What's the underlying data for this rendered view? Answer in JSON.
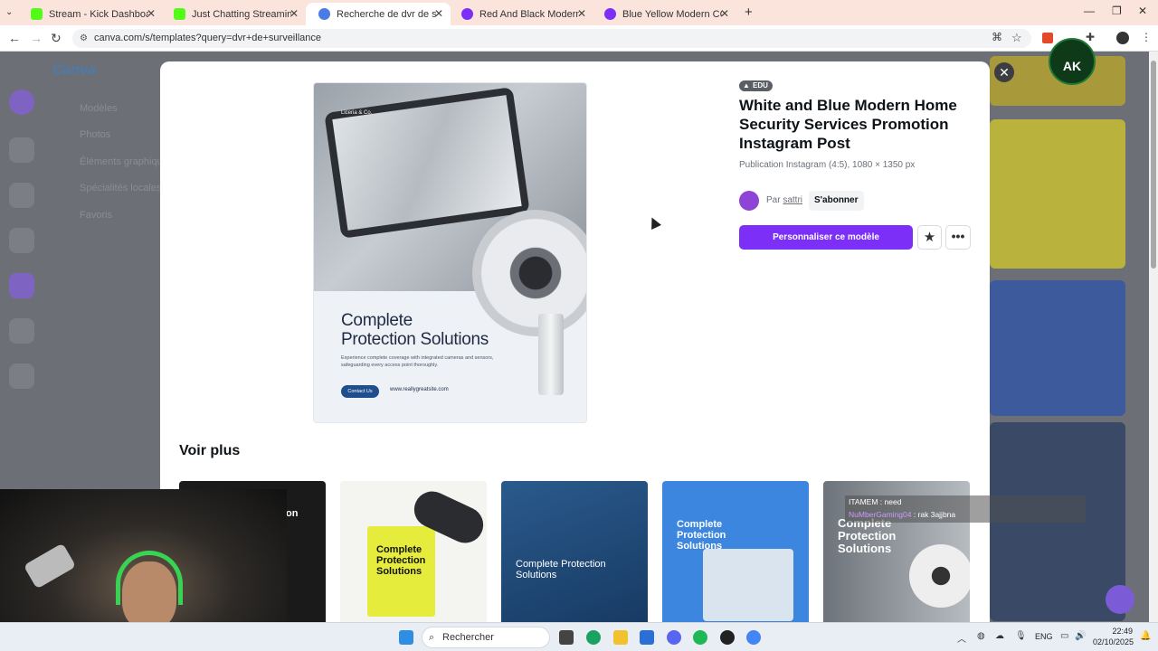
{
  "browser": {
    "tabs": [
      {
        "label": "Stream - Kick Dashboard",
        "favicon_color": "#53fc18"
      },
      {
        "label": "Just Chatting Streaming - Live",
        "favicon_color": "#53fc18"
      },
      {
        "label": "Recherche de dvr de surveillance",
        "favicon_color": "#4b7be5"
      },
      {
        "label": "Red And Black Modern CCTV S",
        "favicon_color": "#7b2ff7"
      },
      {
        "label": "Blue Yellow Modern CCTV Serv",
        "favicon_color": "#7b2ff7"
      }
    ],
    "url": "canva.com/s/templates?query=dvr+de+surveillance"
  },
  "background": {
    "menu": [
      "Modèles",
      "Photos",
      "Éléments graphiques",
      "Spécialités locales",
      "Favoris"
    ]
  },
  "modal": {
    "badge": "EDU",
    "title": "White and Blue Modern Home Security Services Promotion Instagram Post",
    "subtitle": "Publication Instagram (4:5), 1080 × 1350 px",
    "author_prefix": "Par",
    "author": "sattri",
    "subscribe": "S'abonner",
    "customize": "Personnaliser ce modèle",
    "star_icon": "★",
    "more_icon": "•••",
    "close_icon": "✕",
    "see_more": "Voir plus",
    "preview": {
      "brand": "Liceria & Co.",
      "heading_line1": "Complete",
      "heading_line2": "Protection Solutions",
      "description": "Experience complete coverage with integrated cameras and sensors, safeguarding every access point thoroughly.",
      "button": "Contact Us",
      "site": "www.reallygreatsite.com"
    },
    "thumbnails": [
      {
        "text": "on"
      },
      {
        "text": "Complete Protection Solutions"
      },
      {
        "text": "Complete Protection Solutions"
      },
      {
        "text": "Complete Protection Solutions"
      },
      {
        "text": "Complete Protection Solutions"
      }
    ]
  },
  "stream_chat": [
    {
      "user": "ITAMEM",
      "message": "need"
    },
    {
      "user": "NuMberGaming04",
      "message": "rak 3ajjbna"
    }
  ],
  "overlay_logo": "AK",
  "taskbar": {
    "search": "Rechercher",
    "lang": "ENG",
    "time": "22:49",
    "date": "02/10/2025"
  }
}
